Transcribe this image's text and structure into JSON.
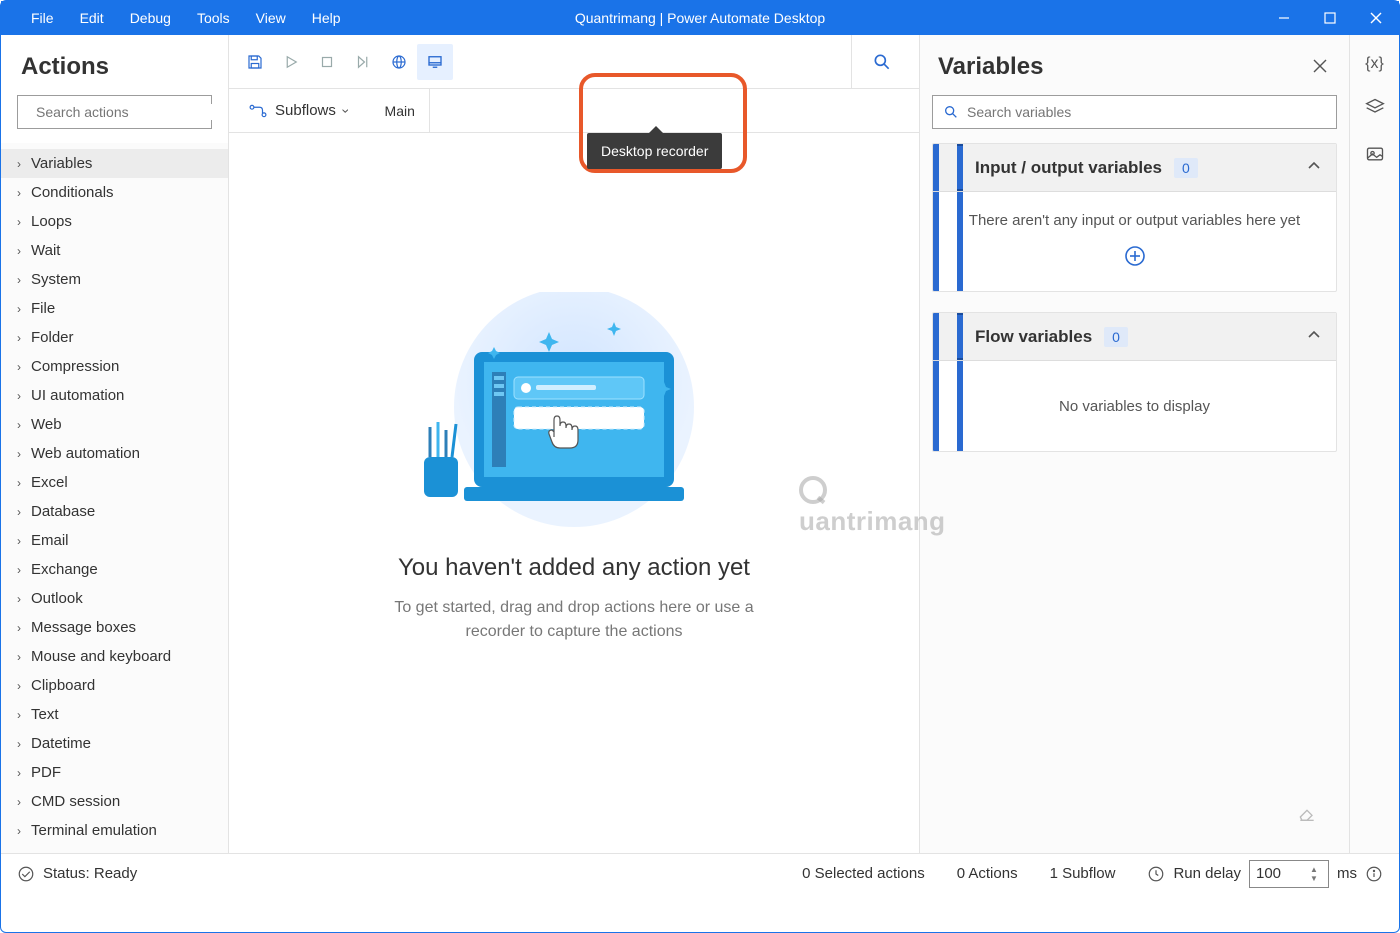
{
  "menubar": [
    "File",
    "Edit",
    "Debug",
    "Tools",
    "View",
    "Help"
  ],
  "app_title": "Quantrimang | Power Automate Desktop",
  "actions": {
    "title": "Actions",
    "search_placeholder": "Search actions",
    "categories": [
      "Variables",
      "Conditionals",
      "Loops",
      "Wait",
      "System",
      "File",
      "Folder",
      "Compression",
      "UI automation",
      "Web",
      "Web automation",
      "Excel",
      "Database",
      "Email",
      "Exchange",
      "Outlook",
      "Message boxes",
      "Mouse and keyboard",
      "Clipboard",
      "Text",
      "Datetime",
      "PDF",
      "CMD session",
      "Terminal emulation"
    ]
  },
  "toolbar": {
    "tooltip": "Desktop recorder",
    "subflows_label": "Subflows",
    "tab_main": "Main"
  },
  "canvas": {
    "title": "You haven't added any action yet",
    "subtitle": "To get started, drag and drop actions here or use a recorder to capture the actions"
  },
  "variables": {
    "title": "Variables",
    "search_placeholder": "Search variables",
    "io_title": "Input / output variables",
    "io_count": "0",
    "io_empty": "There aren't any input or output variables here yet",
    "flow_title": "Flow variables",
    "flow_count": "0",
    "flow_empty": "No variables to display"
  },
  "status": {
    "ready": "Status: Ready",
    "selected": "0 Selected actions",
    "actions": "0 Actions",
    "subflows": "1 Subflow",
    "delay_label": "Run delay",
    "delay_value": "100",
    "delay_unit": "ms"
  },
  "watermark": "uantrimang"
}
